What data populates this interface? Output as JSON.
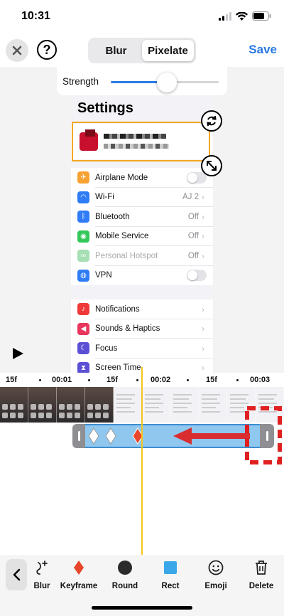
{
  "status_bar": {
    "time": "10:31"
  },
  "header": {
    "close_icon": "close-icon",
    "help_label": "?",
    "mode_options": [
      "Blur",
      "Pixelate"
    ],
    "selected_mode": "Pixelate",
    "save_label": "Save"
  },
  "strength": {
    "label": "Strength",
    "level": 0.52
  },
  "preview": {
    "settings_title": "Settings",
    "groups": [
      [
        {
          "label": "Airplane Mode",
          "icon": "airplane-icon",
          "color": "#f7a233",
          "control": "toggle"
        },
        {
          "label": "Wi-Fi",
          "icon": "wifi-icon",
          "color": "#2f7cf6",
          "value": "AJ 2"
        },
        {
          "label": "Bluetooth",
          "icon": "bluetooth-icon",
          "color": "#2f7cf6",
          "value": "Off"
        },
        {
          "label": "Mobile Service",
          "icon": "antenna-icon",
          "color": "#34c759",
          "value": "Off"
        },
        {
          "label": "Personal Hotspot",
          "icon": "hotspot-icon",
          "color": "#a6dfb4",
          "value": "Off",
          "dimmed": true
        },
        {
          "label": "VPN",
          "icon": "globe-icon",
          "color": "#2f7cf6",
          "control": "toggle"
        }
      ],
      [
        {
          "label": "Notifications",
          "icon": "bell-icon",
          "color": "#f03a3a"
        },
        {
          "label": "Sounds & Haptics",
          "icon": "speaker-icon",
          "color": "#e8365d"
        },
        {
          "label": "Focus",
          "icon": "moon-icon",
          "color": "#5b4fd6"
        },
        {
          "label": "Screen Time",
          "icon": "hourglass-icon",
          "color": "#5b4fd6"
        }
      ]
    ]
  },
  "timeline": {
    "ruler": [
      "15f",
      "00:01",
      "15f",
      "00:02",
      "15f",
      "00:03"
    ]
  },
  "toolbar": {
    "back_icon": "chevron-left-icon",
    "tools": [
      {
        "label": "Blur",
        "icon": "blur-add-icon"
      },
      {
        "label": "Keyframe",
        "icon": "keyframe-icon"
      },
      {
        "label": "Round",
        "icon": "circle-icon"
      },
      {
        "label": "Rect",
        "icon": "square-icon"
      },
      {
        "label": "Emoji",
        "icon": "emoji-icon"
      },
      {
        "label": "Delete",
        "icon": "trash-icon"
      }
    ]
  },
  "colors": {
    "accent": "#2979e0",
    "selection": "#f5a623",
    "playhead": "#f5c518",
    "clip": "#8fc7ee",
    "keyframe": "#e8462a",
    "annotation": "#e02020"
  }
}
